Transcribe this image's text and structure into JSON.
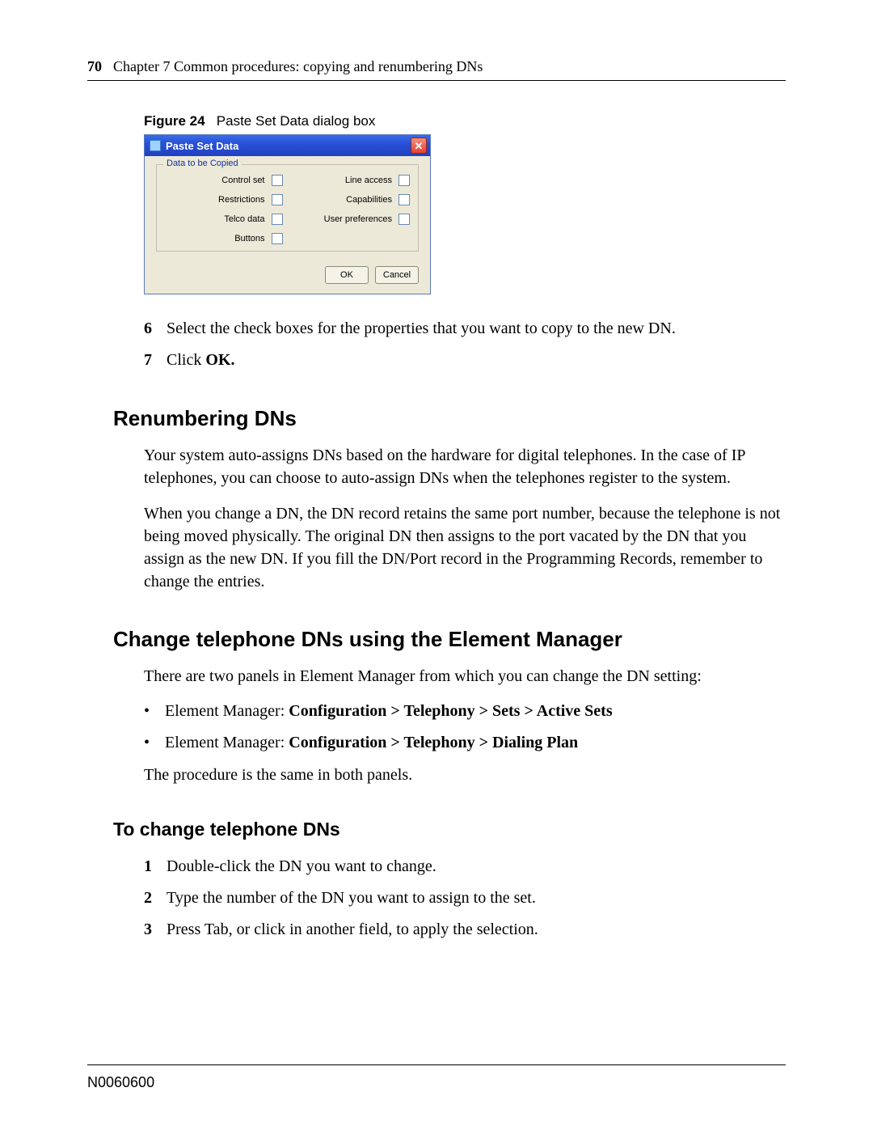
{
  "header": {
    "page_number": "70",
    "chapter": "Chapter 7  Common procedures: copying and renumbering DNs"
  },
  "figure": {
    "label": "Figure 24",
    "caption": "Paste Set Data dialog box"
  },
  "dialog": {
    "title": "Paste Set Data",
    "group_title": "Data to be Copied",
    "checkboxes": {
      "control_set": "Control set",
      "line_access": "Line access",
      "restrictions": "Restrictions",
      "capabilities": "Capabilities",
      "telco_data": "Telco data",
      "user_preferences": "User preferences",
      "buttons": "Buttons"
    },
    "ok": "OK",
    "cancel": "Cancel"
  },
  "steps_a": {
    "6": "Select the check boxes for the properties that you want to copy to the new DN.",
    "7_prefix": "Click ",
    "7_strong": "OK."
  },
  "sections": {
    "renumbering_title": "Renumbering DNs",
    "renumbering_p1": "Your system auto-assigns DNs based on the hardware for digital telephones. In the case of IP telephones, you can choose to auto-assign DNs when the telephones register to the system.",
    "renumbering_p2": "When you change a DN, the DN record retains the same port number, because the telephone is not being moved physically. The original DN then assigns to the port vacated by the DN that you assign as the new DN. If you fill the DN/Port record in the Programming Records, remember to change the entries.",
    "change_title": "Change telephone DNs using the Element Manager",
    "change_intro": "There are two panels in Element Manager from which you can change the DN setting:",
    "bullet1_prefix": "Element Manager: ",
    "bullet1_bold": "Configuration > Telephony > Sets > Active Sets",
    "bullet2_prefix": "Element Manager: ",
    "bullet2_bold": "Configuration > Telephony > Dialing Plan",
    "change_outro": "The procedure is the same in both panels.",
    "tochange_title": "To change telephone DNs",
    "steps_b": {
      "1": "Double-click the DN you want to change.",
      "2": "Type the number of the DN you want to assign to the set.",
      "3": "Press Tab, or click in another field, to apply the selection."
    }
  },
  "footer_id": "N0060600"
}
